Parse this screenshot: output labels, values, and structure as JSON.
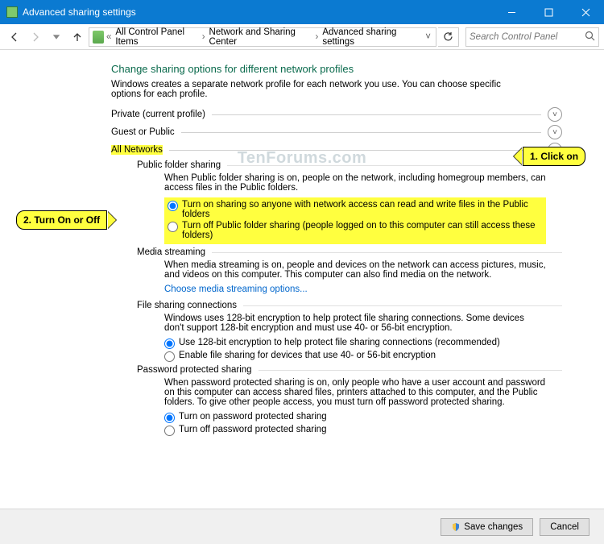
{
  "window": {
    "title": "Advanced sharing settings"
  },
  "nav": {
    "crumbs": [
      "All Control Panel Items",
      "Network and Sharing Center",
      "Advanced sharing settings"
    ],
    "search_placeholder": "Search Control Panel"
  },
  "header": {
    "title": "Change sharing options for different network profiles",
    "desc": "Windows creates a separate network profile for each network you use. You can choose specific options for each profile."
  },
  "sections": {
    "private": "Private (current profile)",
    "guest": "Guest or Public",
    "all": "All Networks"
  },
  "public_folder": {
    "title": "Public folder sharing",
    "desc": "When Public folder sharing is on, people on the network, including homegroup members, can access files in the Public folders.",
    "opt_on": "Turn on sharing so anyone with network access can read and write files in the Public folders",
    "opt_off": "Turn off Public folder sharing (people logged on to this computer can still access these folders)"
  },
  "media": {
    "title": "Media streaming",
    "desc": "When media streaming is on, people and devices on the network can access pictures, music, and videos on this computer. This computer can also find media on the network.",
    "link": "Choose media streaming options..."
  },
  "file_conn": {
    "title": "File sharing connections",
    "desc": "Windows uses 128-bit encryption to help protect file sharing connections. Some devices don't support 128-bit encryption and must use 40- or 56-bit encryption.",
    "opt_128": "Use 128-bit encryption to help protect file sharing connections (recommended)",
    "opt_40": "Enable file sharing for devices that use 40- or 56-bit encryption"
  },
  "password": {
    "title": "Password protected sharing",
    "desc": "When password protected sharing is on, only people who have a user account and password on this computer can access shared files, printers attached to this computer, and the Public folders. To give other people access, you must turn off password protected sharing.",
    "opt_on": "Turn on password protected sharing",
    "opt_off": "Turn off password protected sharing"
  },
  "footer": {
    "save": "Save changes",
    "cancel": "Cancel"
  },
  "annot": {
    "step1": "1. Click on",
    "step2": "2. Turn On or Off"
  },
  "watermark": "TenForums.com"
}
